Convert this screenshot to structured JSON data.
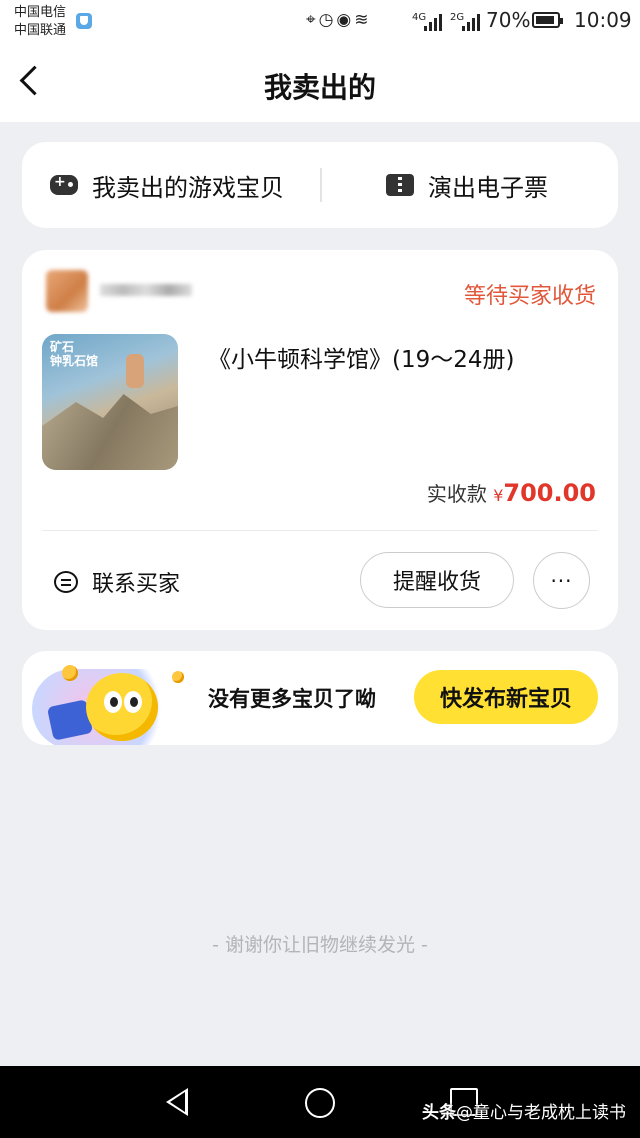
{
  "status_bar": {
    "carrier_1": "中国电信",
    "carrier_2": "中国联通",
    "signal_1": "4G",
    "signal_2": "2G",
    "battery": "70%",
    "time": "10:09"
  },
  "header": {
    "title": "我卖出的"
  },
  "tabs": [
    {
      "label": "我卖出的游戏宝贝",
      "icon": "gamepad-icon"
    },
    {
      "label": "演出电子票",
      "icon": "ticket-icon"
    }
  ],
  "order": {
    "status": "等待买家收货",
    "product_name": "《小牛顿科学馆》(19～24册)",
    "thumb_title_1": "矿石",
    "thumb_title_2": "钟乳石馆",
    "paid_label": "实收款",
    "currency": "¥",
    "amount": "700.00",
    "contact_label": "联系买家",
    "remind_button": "提醒收货",
    "more_button": "···"
  },
  "promo": {
    "text": "没有更多宝贝了呦",
    "button": "快发布新宝贝"
  },
  "footer_note": "- 谢谢你让旧物继续发光 -",
  "watermark": {
    "prefix": "头条",
    "handle": "@童心与老成枕上读书"
  },
  "colors": {
    "status_red": "#e0573a",
    "price_red": "#e0372a",
    "accent_yellow": "#ffe033",
    "page_bg": "#eeeff3"
  }
}
